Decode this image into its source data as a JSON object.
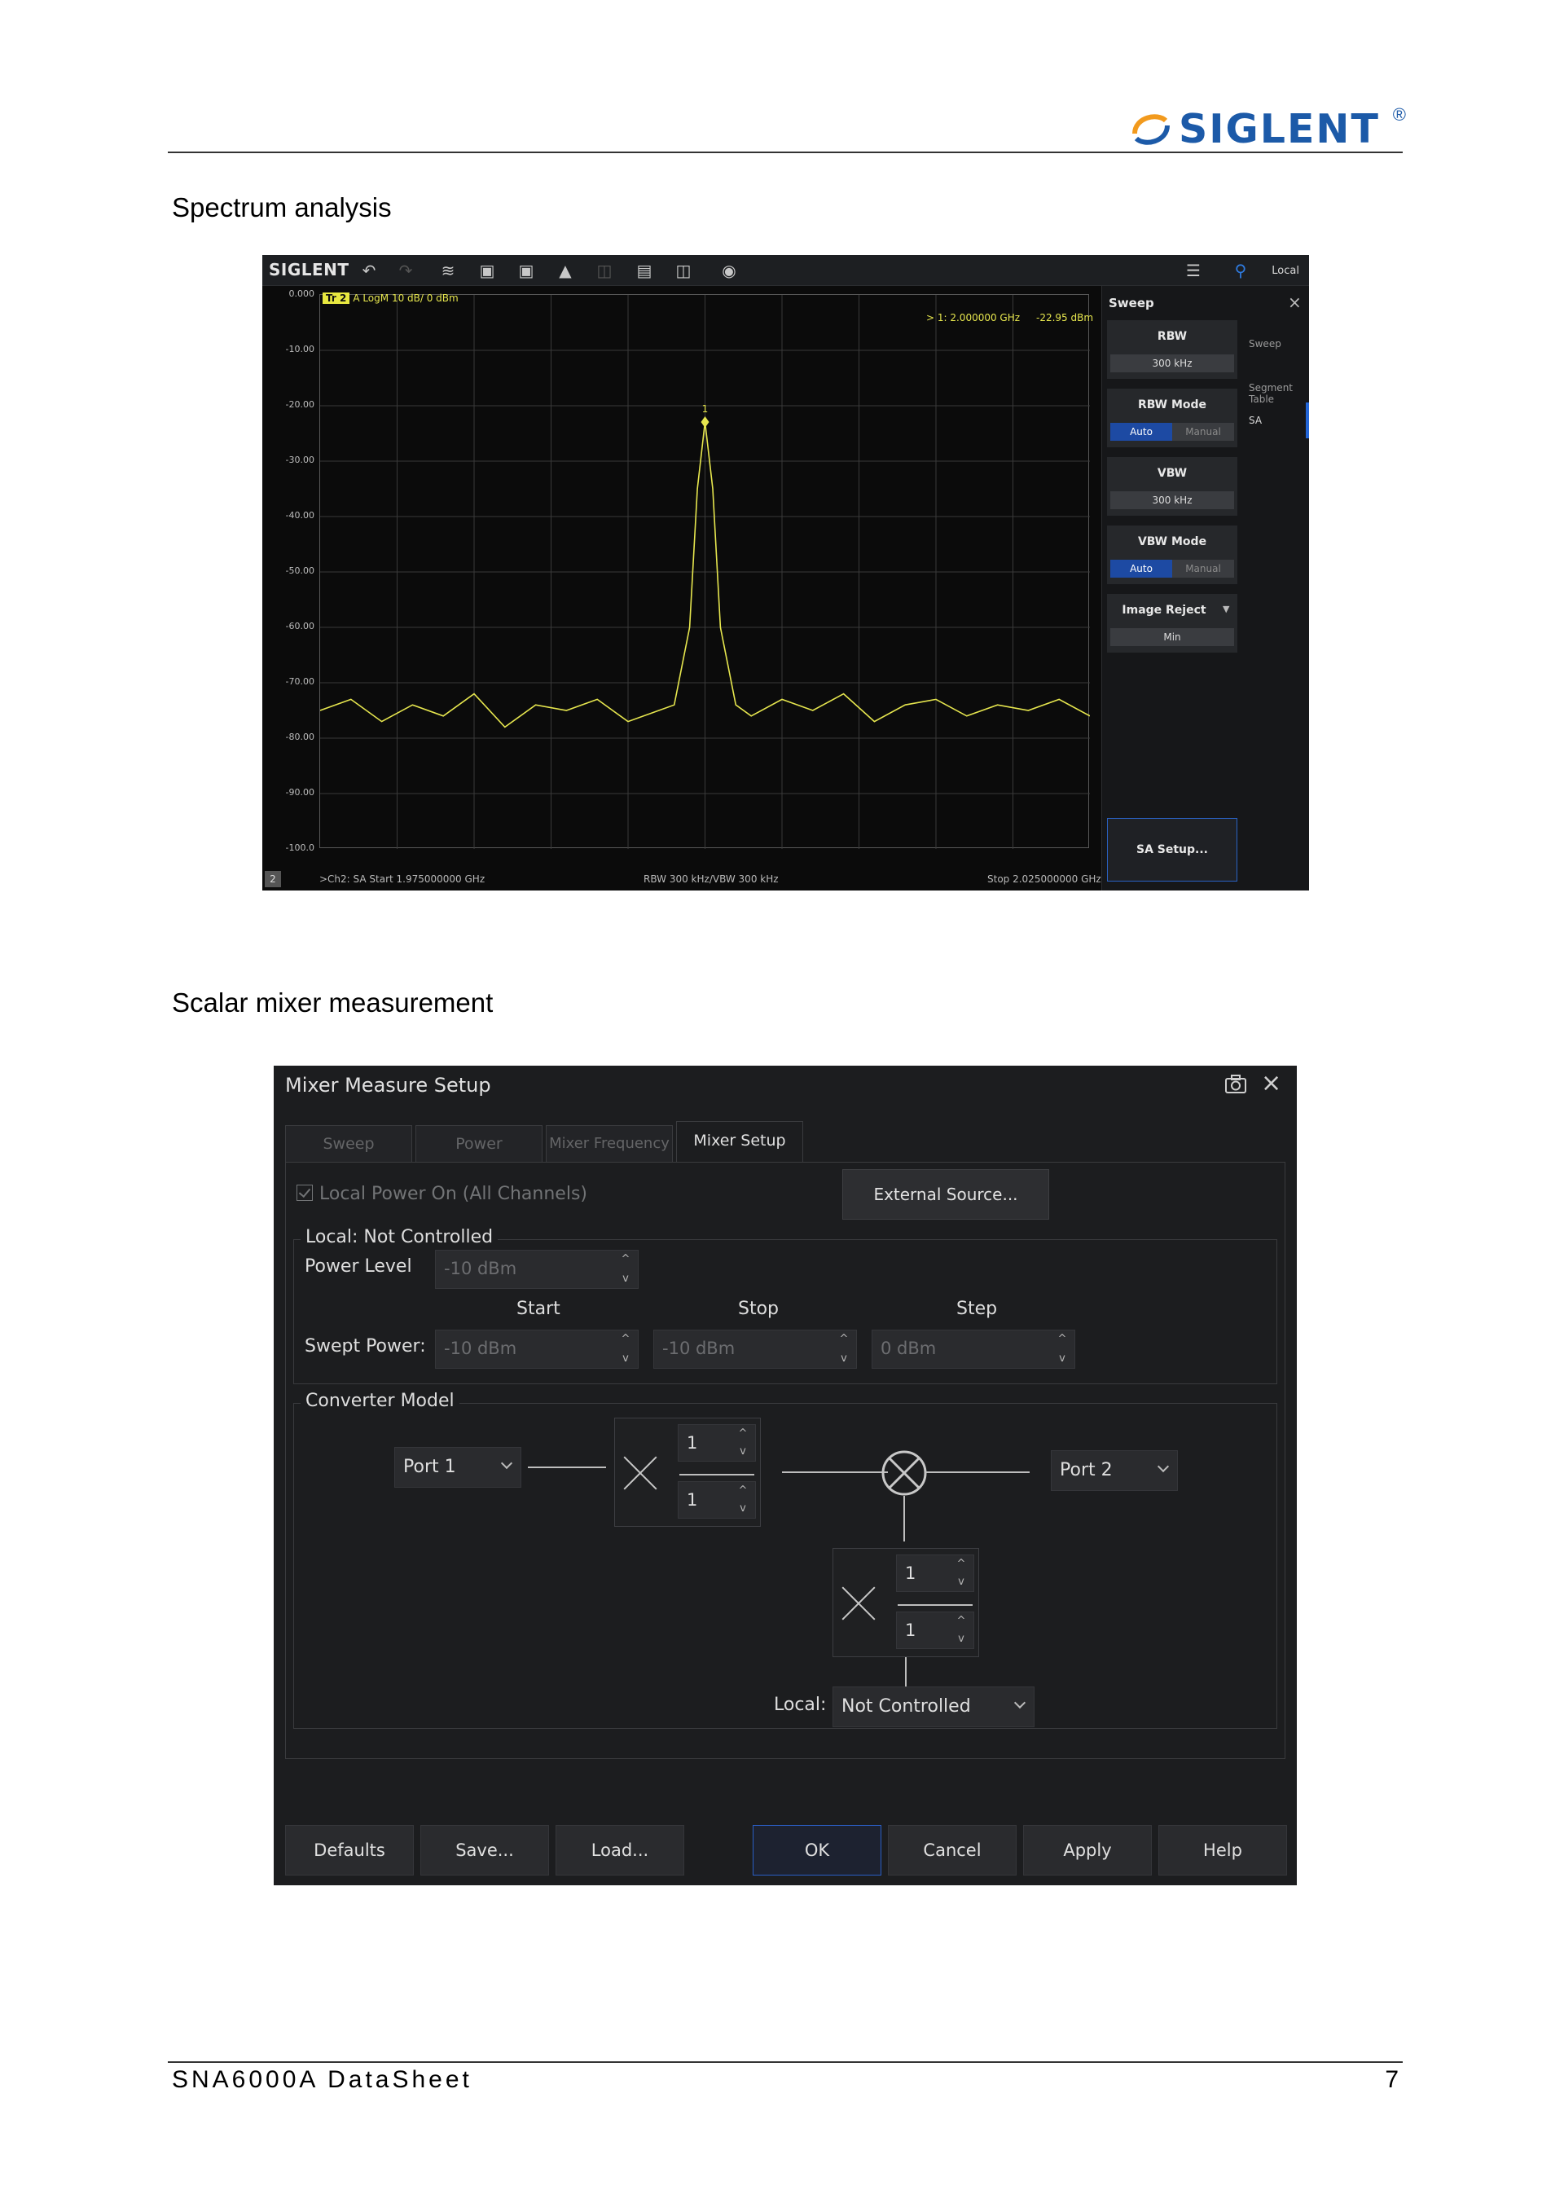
{
  "header": {
    "brand": "SIGLENT",
    "registered_mark": "®"
  },
  "sections": {
    "spectrum_heading": "Spectrum analysis",
    "mixer_heading": "Scalar mixer measurement"
  },
  "footer": {
    "doc_title": "SNA6000A DataSheet",
    "page_number": "7"
  },
  "spectrum": {
    "toolbar": {
      "brand": "SIGLENT",
      "icons": [
        "undo-icon",
        "redo-icon",
        "trace-icon",
        "trace-setup-icon",
        "channel-setup-icon",
        "marker-icon",
        "delete-icon",
        "save-icon",
        "open-icon",
        "camera-icon",
        "menu-list-icon",
        "network-icon"
      ],
      "local_label": "Local"
    },
    "trace_chip": "Tr 2",
    "trace_label": "A  LogM  10 dB/  0 dBm",
    "marker_readout": "> 1:  2.000000 GHz",
    "marker_value": "-22.95 dBm",
    "marker_id": "1",
    "y_ticks": [
      "0.000",
      "-10.00",
      "-20.00",
      "-30.00",
      "-40.00",
      "-50.00",
      "-60.00",
      "-70.00",
      "-80.00",
      "-90.00",
      "-100.0"
    ],
    "status": {
      "channel": "2",
      "start": ">Ch2: SA Start 1.975000000 GHz",
      "bandwidth": "RBW 300 kHz/VBW 300 kHz",
      "stop": "Stop 2.025000000 GHz"
    },
    "menu": {
      "title": "Sweep",
      "rbw_label": "RBW",
      "rbw_value": "300 kHz",
      "rbw_mode_label": "RBW Mode",
      "vbw_label": "VBW",
      "vbw_value": "300 kHz",
      "vbw_mode_label": "VBW Mode",
      "mode_auto": "Auto",
      "mode_manual": "Manual",
      "image_reject_label": "Image Reject",
      "image_reject_value": "Min",
      "setup_button": "SA Setup...",
      "side_items": [
        "Sweep",
        "Segment Table",
        "SA"
      ]
    },
    "chart_data": {
      "type": "line",
      "title": "",
      "xlabel": "",
      "ylabel": "",
      "x_range_ghz": [
        1.975,
        2.025
      ],
      "ylim": [
        -100,
        0
      ],
      "y_unit": "dBm",
      "grid": true,
      "color": "#e6e64e",
      "series": [
        {
          "x_ghz": [
            1.975,
            1.977,
            1.979,
            1.981,
            1.983,
            1.985,
            1.987,
            1.989,
            1.991,
            1.993,
            1.995,
            1.997,
            1.998,
            1.999,
            1.9995,
            2.0,
            2.0005,
            2.001,
            2.002,
            2.003,
            2.005,
            2.007,
            2.009,
            2.011,
            2.013,
            2.015,
            2.017,
            2.019,
            2.021,
            2.023,
            2.025
          ],
          "y_dbm": [
            -75,
            -73,
            -77,
            -74,
            -76,
            -72,
            -78,
            -74,
            -75,
            -73,
            -77,
            -75,
            -74,
            -60,
            -35,
            -22.95,
            -35,
            -60,
            -74,
            -76,
            -73,
            -75,
            -72,
            -77,
            -74,
            -73,
            -76,
            -74,
            -75,
            -73,
            -76
          ]
        }
      ],
      "markers": [
        {
          "id": "1",
          "x_ghz": 2.0,
          "y_dbm": -22.95
        }
      ]
    }
  },
  "mixer": {
    "title": "Mixer Measure Setup",
    "tabs": [
      {
        "label": "Sweep",
        "active": false
      },
      {
        "label": "Power",
        "active": false
      },
      {
        "label": "Mixer Frequency",
        "active": false
      },
      {
        "label": "Mixer Setup",
        "active": true
      }
    ],
    "local_power_on": "Local Power On (All Channels)",
    "external_source_button": "External Source...",
    "local_group": {
      "legend": "Local: Not Controlled",
      "power_level_label": "Power Level",
      "power_level_value": "-10 dBm",
      "col_start": "Start",
      "col_stop": "Stop",
      "col_step": "Step",
      "swept_power_label": "Swept Power:",
      "swept_start": "-10 dBm",
      "swept_stop": "-10 dBm",
      "swept_step": "0 dBm"
    },
    "converter": {
      "legend": "Converter Model",
      "input_port": "Port 1",
      "output_port": "Port 2",
      "input_mult_num": "1",
      "input_mult_den": "1",
      "local_mult_num": "1",
      "local_mult_den": "1",
      "local_label": "Local:",
      "local_value": "Not Controlled"
    },
    "buttons": {
      "defaults": "Defaults",
      "save": "Save...",
      "load": "Load...",
      "ok": "OK",
      "cancel": "Cancel",
      "apply": "Apply",
      "help": "Help"
    }
  }
}
